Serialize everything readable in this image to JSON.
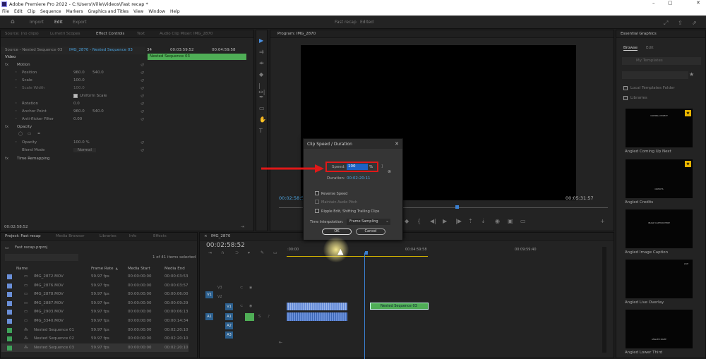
{
  "title_bar": {
    "title": "Adobe Premiere Pro 2022 - C:\\Users\\Ville\\Videos\\Fast recap *"
  },
  "menu": [
    "File",
    "Edit",
    "Clip",
    "Sequence",
    "Markers",
    "Graphics and Titles",
    "View",
    "Window",
    "Help"
  ],
  "workspace": {
    "tabs": [
      "Import",
      "Edit",
      "Export"
    ],
    "project_label": "Fast recap",
    "status": "Edited"
  },
  "source_panel": {
    "tabs": [
      "Source: (no clips)",
      "Lumetri Scopes",
      "Effect Controls",
      "Text",
      "Audio Clip Mixer: IMG_2870"
    ],
    "source_label": "Source - Nested Sequence 03",
    "clip_label": "IMG_2870 - Nested Sequence 03",
    "tc_start": "34",
    "tc_mid": "00:03:59:52",
    "tc_end": "00:04:59:58",
    "clip_bar": "Nested Sequence 03",
    "section": "Video",
    "rows": [
      {
        "name": "Motion",
        "v1": "",
        "v2": ""
      },
      {
        "name": "Position",
        "v1": "960.0",
        "v2": "540.0"
      },
      {
        "name": "Scale",
        "v1": "100.0",
        "v2": ""
      },
      {
        "name": "Scale Width",
        "v1": "100.0",
        "v2": ""
      },
      {
        "name": "Uniform Scale",
        "v1": "",
        "v2": ""
      },
      {
        "name": "Rotation",
        "v1": "0.0",
        "v2": ""
      },
      {
        "name": "Anchor Point",
        "v1": "960.0",
        "v2": "540.0"
      },
      {
        "name": "Anti-flicker Filter",
        "v1": "0.00",
        "v2": ""
      },
      {
        "name": "Opacity",
        "v1": "",
        "v2": ""
      },
      {
        "name": "Opacity",
        "v1": "100.0 %",
        "v2": ""
      },
      {
        "name": "Blend Mode",
        "v1": "Normal",
        "v2": ""
      },
      {
        "name": "Time Remapping",
        "v1": "",
        "v2": ""
      }
    ],
    "timecode": "00:02:58:52"
  },
  "program": {
    "title": "Program: IMG_2870",
    "tc_left": "00:02:58:52",
    "tc_right": "00:05:31:57"
  },
  "dialog": {
    "title": "Clip Speed / Duration",
    "speed_label": "Speed:",
    "speed_value": "100",
    "speed_unit": "%",
    "duration_label": "Duration:",
    "duration_value": "00:02:20:11",
    "checks": [
      "Reverse Speed",
      "Maintain Audio Pitch",
      "Ripple Edit, Shifting Trailing Clips"
    ],
    "interp_label": "Time Interpolation:",
    "interp_value": "Frame Sampling",
    "ok": "OK",
    "cancel": "Cancel"
  },
  "essential": {
    "title": "Essential Graphics",
    "tabs": [
      "Browse",
      "Edit"
    ],
    "dropdown": "My Templates",
    "checks": [
      "Local Templates Folder",
      "Libraries"
    ],
    "templates": [
      {
        "name": "Angled Coming Up Next",
        "text": "COMING UP NEXT"
      },
      {
        "name": "Angled Credits",
        "text": "CREDITS"
      },
      {
        "name": "Angled Image Caption",
        "text": "IMAGE CAPTION HERE"
      },
      {
        "name": "Angled Live Overlay",
        "text": "LIVE"
      },
      {
        "name": "Angled Lower Third",
        "text": "ANGLED NAME"
      }
    ]
  },
  "project": {
    "tabs": [
      "Project: Fast recap",
      "Media Browser",
      "Libraries",
      "Info",
      "Effects"
    ],
    "bin": "Fast recap.prproj",
    "count": "1 of 41 items selected",
    "columns": [
      "Name",
      "Frame Rate",
      "Media Start",
      "Media End"
    ],
    "items": [
      {
        "name": "IMG_2872.MOV",
        "rate": "59.97 fps",
        "start": "00:00:00:00",
        "end": "00:00:03:53",
        "color": "#6a8fd8"
      },
      {
        "name": "IMG_2876.MOV",
        "rate": "59.97 fps",
        "start": "00:00:00:00",
        "end": "00:00:03:57",
        "color": "#6a8fd8"
      },
      {
        "name": "IMG_2878.MOV",
        "rate": "59.97 fps",
        "start": "00:00:00:00",
        "end": "00:00:06:00",
        "color": "#6a8fd8"
      },
      {
        "name": "IMG_2887.MOV",
        "rate": "59.97 fps",
        "start": "00:00:00:00",
        "end": "00:00:09:29",
        "color": "#6a8fd8"
      },
      {
        "name": "IMG_2903.MOV",
        "rate": "59.97 fps",
        "start": "00:00:00:00",
        "end": "00:00:06:13",
        "color": "#6a8fd8"
      },
      {
        "name": "IMG_3340.MOV",
        "rate": "59.97 fps",
        "start": "00:00:00:00",
        "end": "00:00:14:34",
        "color": "#6a8fd8"
      },
      {
        "name": "Nested Sequence 01",
        "rate": "59.97 fps",
        "start": "00:00:00:00",
        "end": "00:02:20:10",
        "color": "#3fa35a"
      },
      {
        "name": "Nested Sequence 02",
        "rate": "59.97 fps",
        "start": "00:00:00:00",
        "end": "00:02:20:10",
        "color": "#3fa35a"
      },
      {
        "name": "Nested Sequence 03",
        "rate": "59.97 fps",
        "start": "00:00:00:00",
        "end": "00:02:20:10",
        "color": "#3fa35a"
      }
    ]
  },
  "timeline": {
    "tab": "IMG_2870",
    "timecode": "00:02:58:52",
    "ruler": [
      ":00:00",
      "00:04:59:58",
      "00:09:59:40"
    ],
    "tracks_v": [
      "V3",
      "V2",
      "V1"
    ],
    "tracks_a": [
      "A1",
      "A2",
      "A3"
    ],
    "clip_label": "Nested Sequence 03"
  }
}
